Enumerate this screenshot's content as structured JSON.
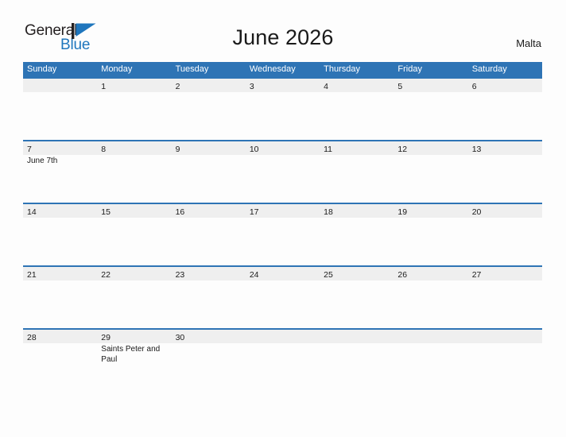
{
  "brand": {
    "name_part1": "General",
    "name_part2": "Blue",
    "logo_icon": "triangle-flag-icon",
    "accent_color": "#1f76bd"
  },
  "header": {
    "title": "June 2026",
    "region": "Malta"
  },
  "theme": {
    "header_band_color": "#2e74b5",
    "date_band_color": "#efefef",
    "divider_color": "#2e74b5",
    "page_background": "#fdfdfd",
    "text_color": "#1a1a1a"
  },
  "calendar": {
    "weekdays": [
      "Sunday",
      "Monday",
      "Tuesday",
      "Wednesday",
      "Thursday",
      "Friday",
      "Saturday"
    ],
    "weeks": [
      {
        "days": [
          {
            "num": "",
            "event": ""
          },
          {
            "num": "1",
            "event": ""
          },
          {
            "num": "2",
            "event": ""
          },
          {
            "num": "3",
            "event": ""
          },
          {
            "num": "4",
            "event": ""
          },
          {
            "num": "5",
            "event": ""
          },
          {
            "num": "6",
            "event": ""
          }
        ]
      },
      {
        "days": [
          {
            "num": "7",
            "event": "June 7th"
          },
          {
            "num": "8",
            "event": ""
          },
          {
            "num": "9",
            "event": ""
          },
          {
            "num": "10",
            "event": ""
          },
          {
            "num": "11",
            "event": ""
          },
          {
            "num": "12",
            "event": ""
          },
          {
            "num": "13",
            "event": ""
          }
        ]
      },
      {
        "days": [
          {
            "num": "14",
            "event": ""
          },
          {
            "num": "15",
            "event": ""
          },
          {
            "num": "16",
            "event": ""
          },
          {
            "num": "17",
            "event": ""
          },
          {
            "num": "18",
            "event": ""
          },
          {
            "num": "19",
            "event": ""
          },
          {
            "num": "20",
            "event": ""
          }
        ]
      },
      {
        "days": [
          {
            "num": "21",
            "event": ""
          },
          {
            "num": "22",
            "event": ""
          },
          {
            "num": "23",
            "event": ""
          },
          {
            "num": "24",
            "event": ""
          },
          {
            "num": "25",
            "event": ""
          },
          {
            "num": "26",
            "event": ""
          },
          {
            "num": "27",
            "event": ""
          }
        ]
      },
      {
        "days": [
          {
            "num": "28",
            "event": ""
          },
          {
            "num": "29",
            "event": "Saints Peter and Paul"
          },
          {
            "num": "30",
            "event": ""
          },
          {
            "num": "",
            "event": ""
          },
          {
            "num": "",
            "event": ""
          },
          {
            "num": "",
            "event": ""
          },
          {
            "num": "",
            "event": ""
          }
        ]
      }
    ]
  }
}
